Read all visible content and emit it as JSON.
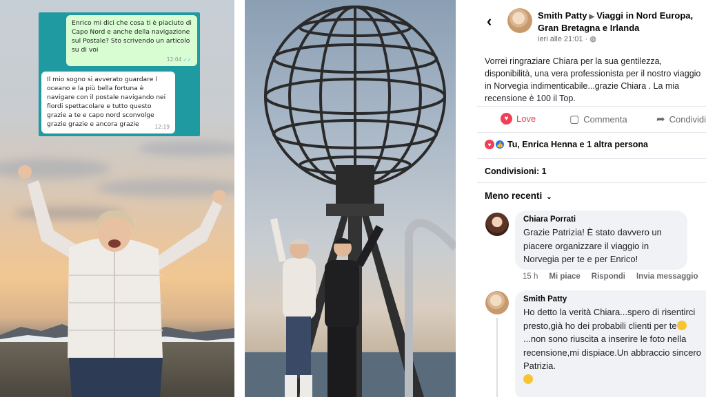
{
  "chat": {
    "outgoing": {
      "text": "Enrico mi dici che cosa ti è piaciuto di Capo Nord e anche della navigazione sul Postale? Sto scrivendo un articolo su di voi",
      "time": "12:04"
    },
    "incoming": {
      "text": "Il mio sogno si avverato guardare l oceano e la più bella fortuna è navigare con il postale navigando nei fiordi spettacolare e tutto questo grazie a te e capo nord sconvolge grazie grazie e ancora grazie",
      "time": "12:19"
    }
  },
  "post": {
    "author": "Smith Patty",
    "group": "Viaggi in Nord Europa, Gran Bretagna e Irlanda",
    "time": "ieri alle 21:01 ·",
    "text": "Vorrei  ringraziare Chiara per la sua gentilezza, disponibilità, una vera professionista per il nostro viaggio in Norvegia  indimenticabile...grazie  Chiara . La mia recensione è  100 il Top.",
    "actions": {
      "love": "Love",
      "comment": "Commenta",
      "share": "Condividi"
    },
    "reactions": "Tu, Enrica Henna e 1 altra persona",
    "shares": "Condivisioni: 1",
    "sort": "Meno recenti"
  },
  "comments": [
    {
      "author": "Chiara Porrati",
      "text": "Grazie Patrizia! È stato davvero un piacere organizzare il viaggio in Norvegia per te e per Enrico!",
      "time": "15 h",
      "like": "Mi piace",
      "reply": "Rispondi",
      "send": "Invia messaggio"
    },
    {
      "author": "Smith Patty",
      "text_1": "Ho detto la verità Chiara...spero di risentirci presto,già ho dei probabili clienti per te",
      "text_2": "...non sono riuscita a inserire le foto nella recensione,mi dispiace.Un abbraccio sincero Patrizia."
    }
  ],
  "icons": [
    "back-arrow-icon",
    "globe-icon",
    "heart-icon",
    "comment-icon",
    "share-icon",
    "like-icon",
    "chevron-down-icon",
    "grin-emoji-icon",
    "kiss-emoji-icon"
  ],
  "colors": {
    "love": "#f33e58",
    "like": "#1877f2",
    "chat_bg": "#1f9aa0",
    "bubble_out": "#d9fdd3"
  }
}
